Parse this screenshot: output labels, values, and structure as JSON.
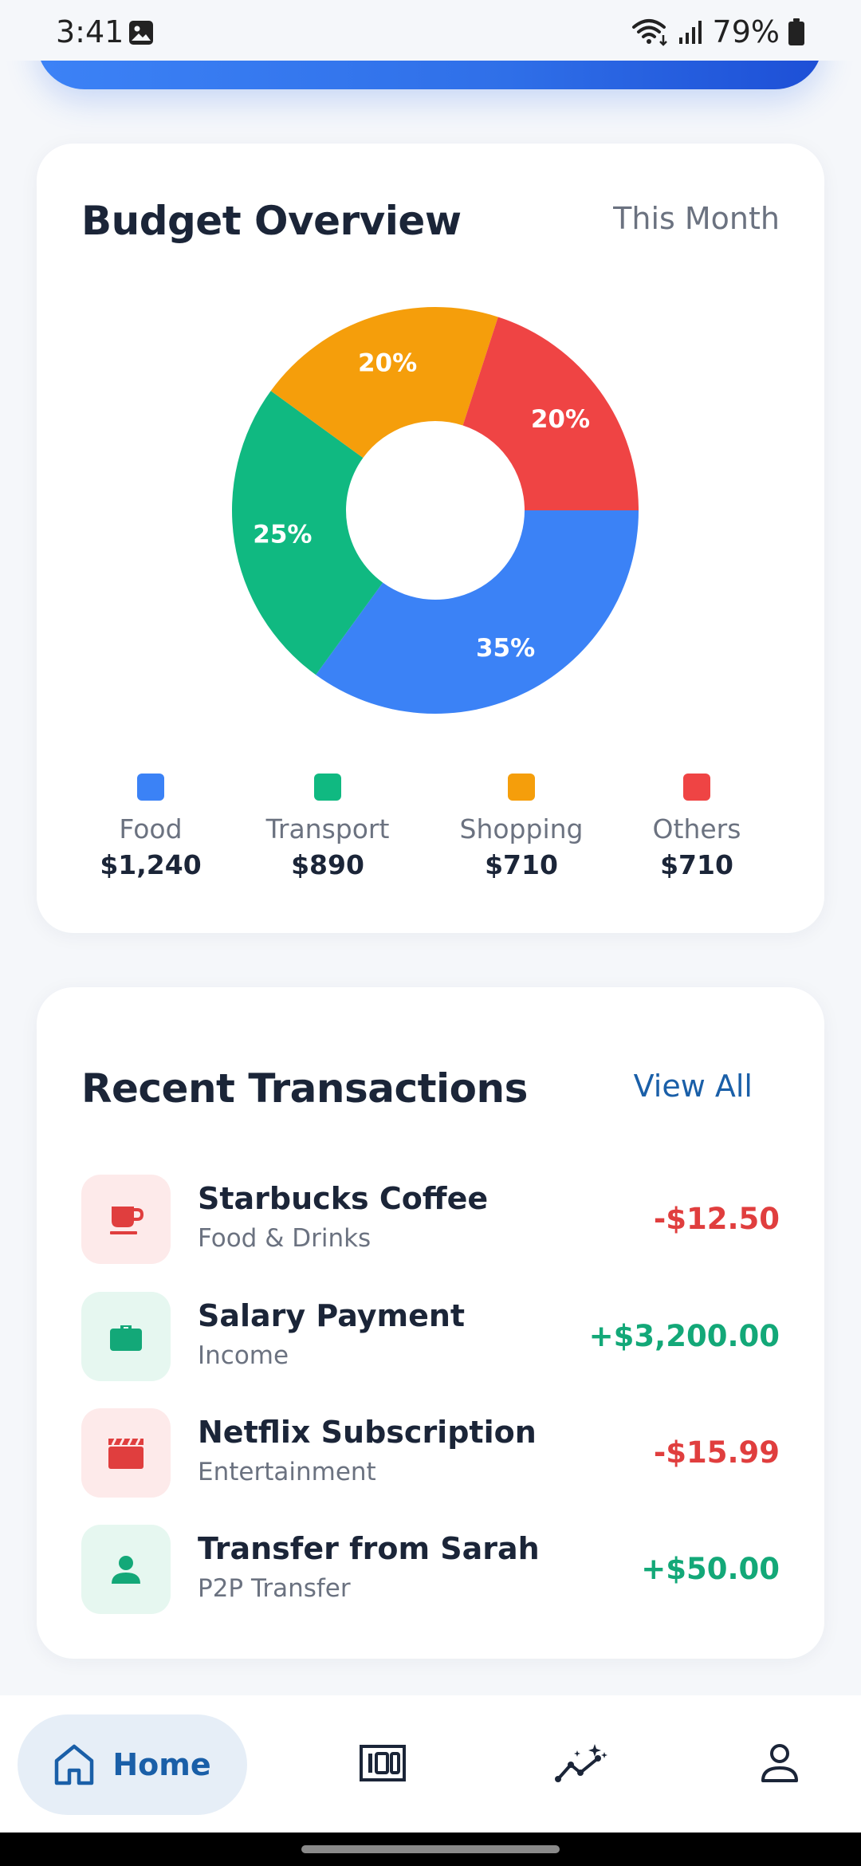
{
  "status_bar": {
    "time": "3:41",
    "battery": "79%",
    "icons": [
      "image-icon",
      "wifi-icon",
      "signal-icon",
      "battery-icon"
    ]
  },
  "budget": {
    "title": "Budget Overview",
    "period": "This Month",
    "chart_data": {
      "type": "pie",
      "categories": [
        "Food",
        "Transport",
        "Shopping",
        "Others"
      ],
      "values": [
        35,
        25,
        20,
        20
      ],
      "value_labels": [
        "35%",
        "25%",
        "20%",
        "20%"
      ],
      "amounts": [
        "$1,240",
        "$890",
        "$710",
        "$710"
      ],
      "colors": [
        "#3b82f6",
        "#10b981",
        "#f59e0b",
        "#ef4444"
      ],
      "donut": true,
      "legend_position": "bottom"
    }
  },
  "transactions": {
    "title": "Recent Transactions",
    "view_all": "View All",
    "items": [
      {
        "name": "Starbucks Coffee",
        "category": "Food & Drinks",
        "amount": "-$12.50",
        "icon": "coffee-cup-icon",
        "tone": "red"
      },
      {
        "name": "Salary Payment",
        "category": "Income",
        "amount": "+$3,200.00",
        "icon": "briefcase-icon",
        "tone": "green"
      },
      {
        "name": "Netflix Subscription",
        "category": "Entertainment",
        "amount": "-$15.99",
        "icon": "clapperboard-icon",
        "tone": "red"
      },
      {
        "name": "Transfer from Sarah",
        "category": "P2P Transfer",
        "amount": "+$50.00",
        "icon": "person-icon",
        "tone": "green"
      }
    ]
  },
  "nav": {
    "home_label": "Home",
    "items": [
      "home-icon",
      "cash-icon",
      "analytics-icon",
      "profile-icon"
    ]
  },
  "colors": {
    "accent": "#1a5fa8",
    "banner_blue": "#2f6fe8",
    "negative": "#e03e3e",
    "positive": "#13a878"
  }
}
